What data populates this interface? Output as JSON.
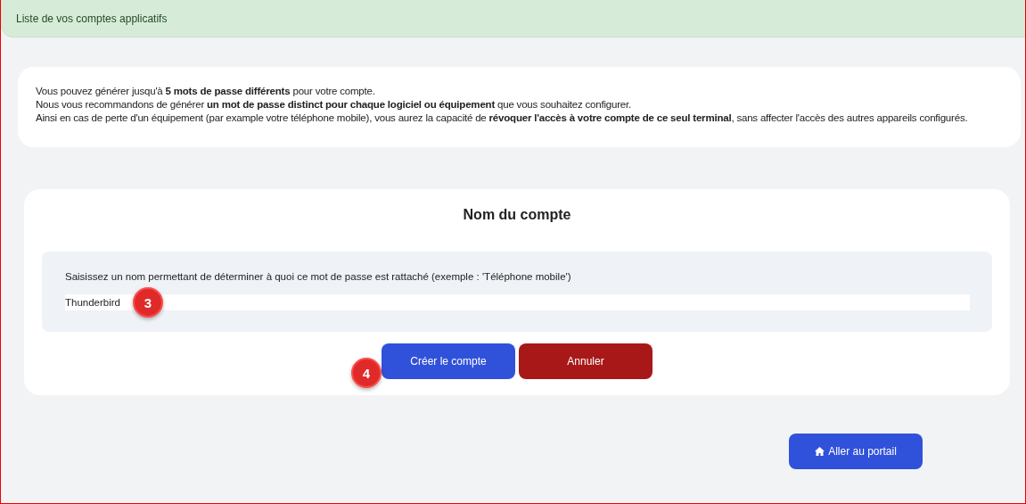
{
  "header": {
    "title": "Liste de vos comptes applicatifs"
  },
  "info": {
    "lines": [
      "Vous pouvez générer jusqu'à **5 mots de passe différents** pour votre compte.",
      "Nous vous recommandons de générer **un mot de passe distinct pour chaque logiciel ou équipement** que vous souhaitez configurer.",
      "Ainsi en cas de perte d'un équipement (par example votre téléphone mobile), vous aurez la capacité de **révoquer l'accès à votre compte de ce seul terminal**, sans affecter l'accès des autres appareils configurés."
    ]
  },
  "form": {
    "title": "Nom du compte",
    "hint": "Saisissez un nom permettant de déterminer à quoi ce mot de passe est rattaché (exemple : 'Téléphone mobile')",
    "value": "Thunderbird",
    "field_marker": "3",
    "submit_marker": "4",
    "submit": "Créer le compte",
    "cancel": "Annuler"
  },
  "portal_button": "Aller au portail"
}
